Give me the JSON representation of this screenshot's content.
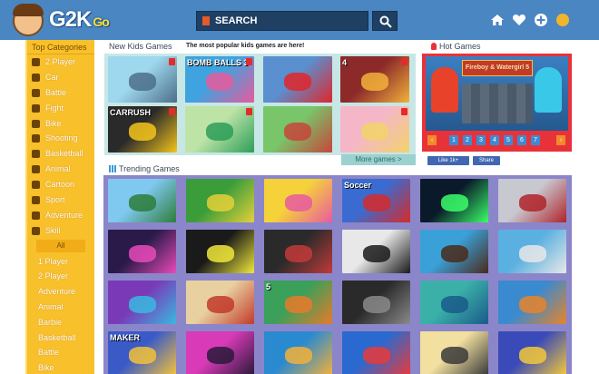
{
  "header": {
    "logo_text": "G2K",
    "logo_suffix": "Go",
    "search_label": "SEARCH"
  },
  "header_icons": [
    "home-icon",
    "heart-icon",
    "plus-icon",
    "coin-icon"
  ],
  "sidebar": {
    "title": "Top Categories",
    "items": [
      {
        "label": "2 Player",
        "icon": "two-player-icon"
      },
      {
        "label": "Car",
        "icon": "car-icon"
      },
      {
        "label": "Battle",
        "icon": "battle-icon"
      },
      {
        "label": "Fight",
        "icon": "fight-icon"
      },
      {
        "label": "Bike",
        "icon": "bike-icon"
      },
      {
        "label": "Shooting",
        "icon": "shooting-icon"
      },
      {
        "label": "Basketball",
        "icon": "basketball-icon"
      },
      {
        "label": "Animal",
        "icon": "animal-icon"
      },
      {
        "label": "Cartoon",
        "icon": "cartoon-icon"
      },
      {
        "label": "Sport",
        "icon": "sport-icon"
      },
      {
        "label": "Adventure",
        "icon": "adventure-icon"
      },
      {
        "label": "Skill",
        "icon": "skill-icon"
      }
    ],
    "all_label": "All",
    "sub_items": [
      "1 Player",
      "2 Player",
      "Adventure",
      "Animal",
      "Barbie",
      "Basketball",
      "Battle",
      "Bike"
    ]
  },
  "new_games": {
    "title": "New Kids Games",
    "subtitle": "The most popular kids games are here!",
    "more_label": "More games >",
    "thumbs": [
      {
        "caption": "",
        "colors": [
          "#9ed8ee",
          "#4c6e8a"
        ]
      },
      {
        "caption": "BOMB BALLS 3",
        "colors": [
          "#3fa3e0",
          "#e85a9c"
        ]
      },
      {
        "caption": "",
        "colors": [
          "#5a8fd0",
          "#e0262a"
        ]
      },
      {
        "caption": "4",
        "colors": [
          "#8c2a2a",
          "#f2b23a"
        ]
      },
      {
        "caption": "CARRUSH",
        "colors": [
          "#2a2a2a",
          "#f4c41b"
        ]
      },
      {
        "caption": "",
        "colors": [
          "#bde4a6",
          "#2d9e58"
        ]
      },
      {
        "caption": "",
        "colors": [
          "#79c56a",
          "#c7453a"
        ]
      },
      {
        "caption": "",
        "colors": [
          "#f5b7c7",
          "#f2d36a"
        ]
      }
    ]
  },
  "hot_games": {
    "title": "Hot Games",
    "feature_caption": "Fireboy & Watergirl 5",
    "pages": [
      "1",
      "2",
      "3",
      "4",
      "5",
      "6",
      "7"
    ],
    "like_label": "Like 1k+",
    "share_label": "Share"
  },
  "trending": {
    "title": "Trending Games",
    "thumbs": [
      {
        "caption": "",
        "colors": [
          "#7fc8f0",
          "#2d7d3a"
        ]
      },
      {
        "caption": "",
        "colors": [
          "#3a9d3a",
          "#e4d03a"
        ]
      },
      {
        "caption": "",
        "colors": [
          "#f5d23a",
          "#e85aa0"
        ]
      },
      {
        "caption": "Soccer",
        "colors": [
          "#3a6bd0",
          "#d62a2a"
        ]
      },
      {
        "caption": "",
        "colors": [
          "#0a1a2a",
          "#3aff6a"
        ]
      },
      {
        "caption": "",
        "colors": [
          "#c8c8d0",
          "#b0232a"
        ]
      },
      {
        "caption": "",
        "colors": [
          "#2a1a4a",
          "#e84ab8"
        ]
      },
      {
        "caption": "",
        "colors": [
          "#1a1a1a",
          "#f0e83a"
        ]
      },
      {
        "caption": "",
        "colors": [
          "#2a2a2a",
          "#c23a3a"
        ]
      },
      {
        "caption": "",
        "colors": [
          "#e8e8e8",
          "#1a1a1a"
        ]
      },
      {
        "caption": "",
        "colors": [
          "#3aa0d8",
          "#4a2a1a"
        ]
      },
      {
        "caption": "",
        "colors": [
          "#5ab0e0",
          "#e8e8e8"
        ]
      },
      {
        "caption": "",
        "colors": [
          "#7a3ab8",
          "#3ab8e0"
        ]
      },
      {
        "caption": "",
        "colors": [
          "#e8d0a0",
          "#c23a2a"
        ]
      },
      {
        "caption": "5",
        "colors": [
          "#3aa05a",
          "#e87a2a"
        ]
      },
      {
        "caption": "",
        "colors": [
          "#2a2a2a",
          "#8a8a8a"
        ]
      },
      {
        "caption": "",
        "colors": [
          "#3ab0a8",
          "#1a5a8a"
        ]
      },
      {
        "caption": "",
        "colors": [
          "#3a8ad0",
          "#e8842a"
        ]
      },
      {
        "caption": "MAKER",
        "colors": [
          "#3a5ac8",
          "#f2c23a"
        ]
      },
      {
        "caption": "",
        "colors": [
          "#d83ab8",
          "#2a1a3a"
        ]
      },
      {
        "caption": "",
        "colors": [
          "#2a8ad0",
          "#f2b03a"
        ]
      },
      {
        "caption": "",
        "colors": [
          "#2a6ad0",
          "#e83a3a"
        ]
      },
      {
        "caption": "",
        "colors": [
          "#f2e0a0",
          "#3a3a3a"
        ]
      },
      {
        "caption": "",
        "colors": [
          "#3a4ab8",
          "#f2c83a"
        ]
      }
    ]
  }
}
